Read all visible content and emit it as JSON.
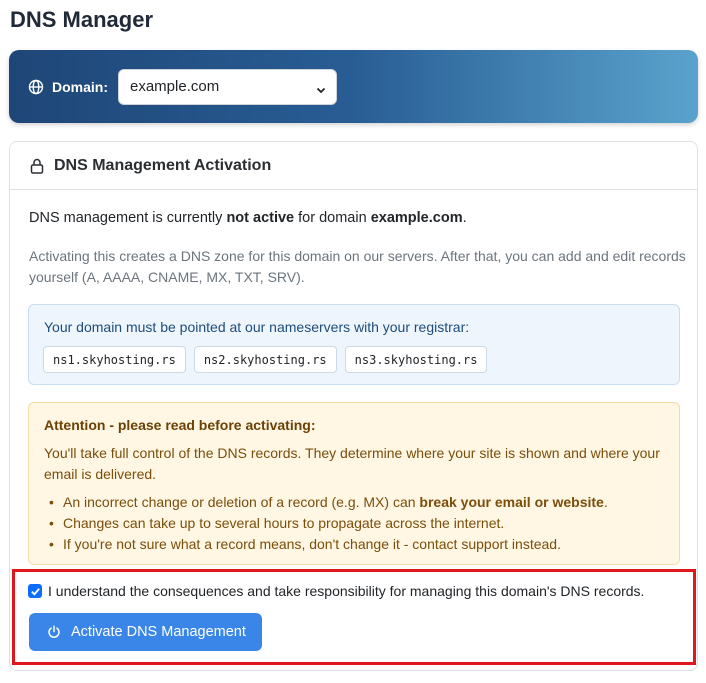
{
  "page": {
    "title": "DNS Manager"
  },
  "domain_bar": {
    "label": "Domain:",
    "selected": "example.com",
    "icon": "globe-icon"
  },
  "card": {
    "title": "DNS Management Activation",
    "status": {
      "prefix": "DNS management is currently ",
      "state": "not active",
      "middle": " for domain ",
      "domain": "example.com",
      "suffix": "."
    },
    "help": "Activating this creates a DNS zone for this domain on our servers. After that, you can add and edit records yourself (A, AAAA, CNAME, MX, TXT, SRV).",
    "nameservers": {
      "text": "Your domain must be pointed at our nameservers with your registrar:",
      "items": [
        "ns1.skyhosting.rs",
        "ns2.skyhosting.rs",
        "ns3.skyhosting.rs"
      ]
    },
    "warning": {
      "title": "Attention - please read before activating:",
      "text": "You'll take full control of the DNS records. They determine where your site is shown and where your email is delivered.",
      "bullet1_prefix": "An incorrect change or deletion of a record (e.g. MX) can ",
      "bullet1_bold": "break your email or website",
      "bullet1_suffix": ".",
      "bullet2": "Changes can take up to several hours to propagate across the internet.",
      "bullet3": "If you're not sure what a record means, don't change it - contact support instead."
    },
    "confirm": {
      "checked": true,
      "label": "I understand the consequences and take responsibility for managing this domain's DNS records."
    },
    "button": {
      "label": "Activate DNS Management"
    }
  },
  "colors": {
    "primary": "#3a86e8",
    "header_gradient_start": "#1f4677",
    "header_gradient_end": "#5aa3cd",
    "highlight": "#e0161d"
  }
}
